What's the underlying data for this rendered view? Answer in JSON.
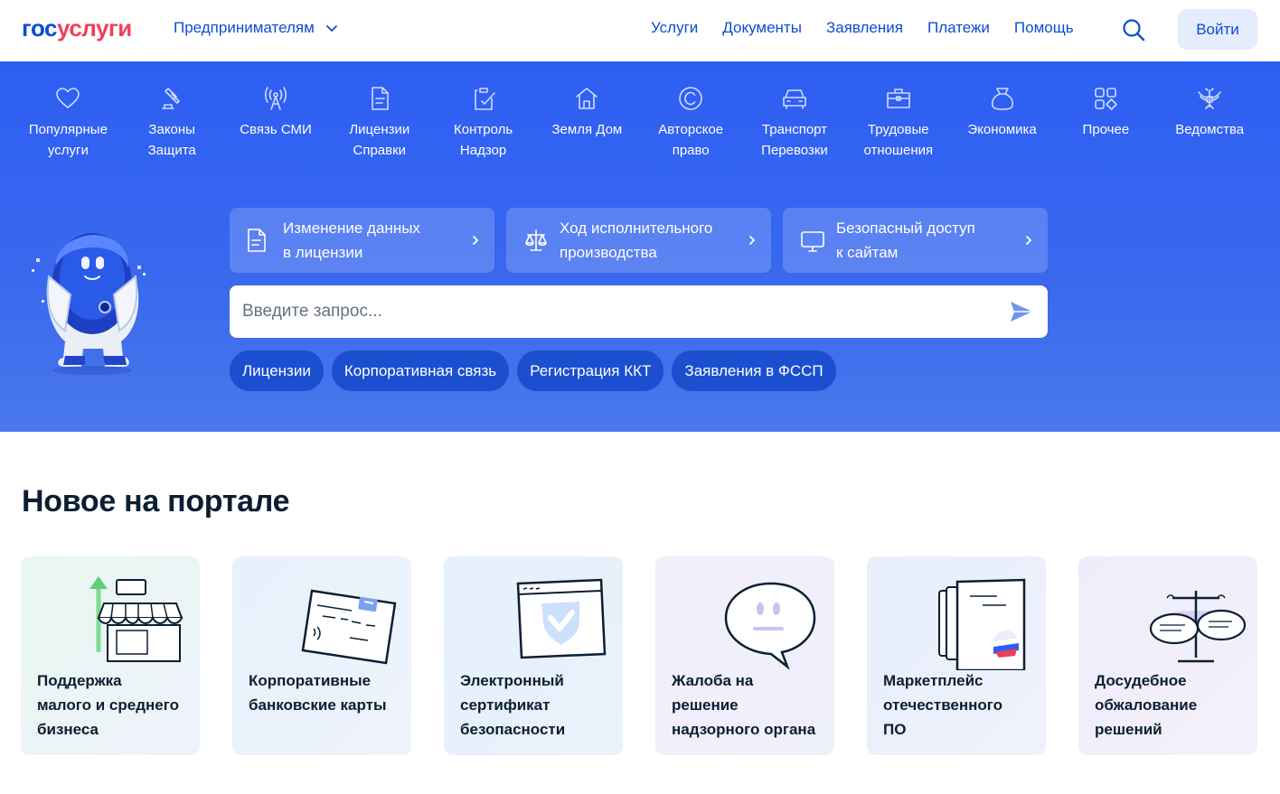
{
  "header": {
    "logo_part1": "гос",
    "logo_part2": "услуги",
    "segment": "Предпринимателям",
    "nav": [
      "Услуги",
      "Документы",
      "Заявления",
      "Платежи",
      "Помощь"
    ],
    "login": "Войти"
  },
  "categories": [
    {
      "line1": "Популярные",
      "line2": "услуги",
      "icon": "heart-icon"
    },
    {
      "line1": "Законы",
      "line2": "Защита",
      "icon": "gavel-icon"
    },
    {
      "line1": "Связь СМИ",
      "line2": "",
      "icon": "antenna-icon"
    },
    {
      "line1": "Лицензии",
      "line2": "Справки",
      "icon": "document-icon"
    },
    {
      "line1": "Контроль",
      "line2": "Надзор",
      "icon": "clipboard-check-icon"
    },
    {
      "line1": "Земля Дом",
      "line2": "",
      "icon": "house-icon"
    },
    {
      "line1": "Авторское",
      "line2": "право",
      "icon": "copyright-icon"
    },
    {
      "line1": "Транспорт",
      "line2": "Перевозки",
      "icon": "car-icon"
    },
    {
      "line1": "Трудовые",
      "line2": "отношения",
      "icon": "briefcase-icon"
    },
    {
      "line1": "Экономика",
      "line2": "",
      "icon": "bag-icon"
    },
    {
      "line1": "Прочее",
      "line2": "",
      "icon": "grid-icon"
    },
    {
      "line1": "Ведомства",
      "line2": "",
      "icon": "eagle-icon"
    }
  ],
  "quicklinks": [
    {
      "line1": "Изменение данных",
      "line2": "в лицензии",
      "icon": "document-icon"
    },
    {
      "line1": "Ход исполнительного",
      "line2": "производства",
      "icon": "scales-icon"
    },
    {
      "line1": "Безопасный доступ",
      "line2": "к сайтам",
      "icon": "monitor-icon"
    }
  ],
  "search": {
    "placeholder": "Введите запрос..."
  },
  "chips": [
    "Лицензии",
    "Корпоративная связь",
    "Регистрация ККТ",
    "Заявления в ФССП"
  ],
  "section": {
    "title": "Новое на портале"
  },
  "cards": [
    {
      "lines": [
        "Поддержка",
        "малого и среднего",
        "бизнеса"
      ],
      "icon": "shop-icon",
      "bg": "#eaf6f1"
    },
    {
      "lines": [
        "Корпоративные",
        "банковские карты"
      ],
      "icon": "bank-card-icon",
      "bg": "#e9f0fb"
    },
    {
      "lines": [
        "Электронный",
        "сертификат",
        "безопасности"
      ],
      "icon": "browser-shield-icon",
      "bg": "#e8f1fb"
    },
    {
      "lines": [
        "Жалоба на",
        "решение",
        "надзорного органа"
      ],
      "icon": "sad-speech-bubble-icon",
      "bg": "#f1eefb"
    },
    {
      "lines": [
        "Маркетплейс",
        "отечественного",
        "ПО"
      ],
      "icon": "certificate-icon",
      "bg": "#eaf0fb"
    },
    {
      "lines": [
        "Досудебное",
        "обжалование",
        "решений"
      ],
      "icon": "scales-dialog-icon",
      "bg": "#eeeefb"
    }
  ],
  "colors": {
    "brand_blue": "#0d4cd3",
    "brand_red": "#ee3f58",
    "hero": "#2d5ef3",
    "chip": "#1b4fcf"
  }
}
